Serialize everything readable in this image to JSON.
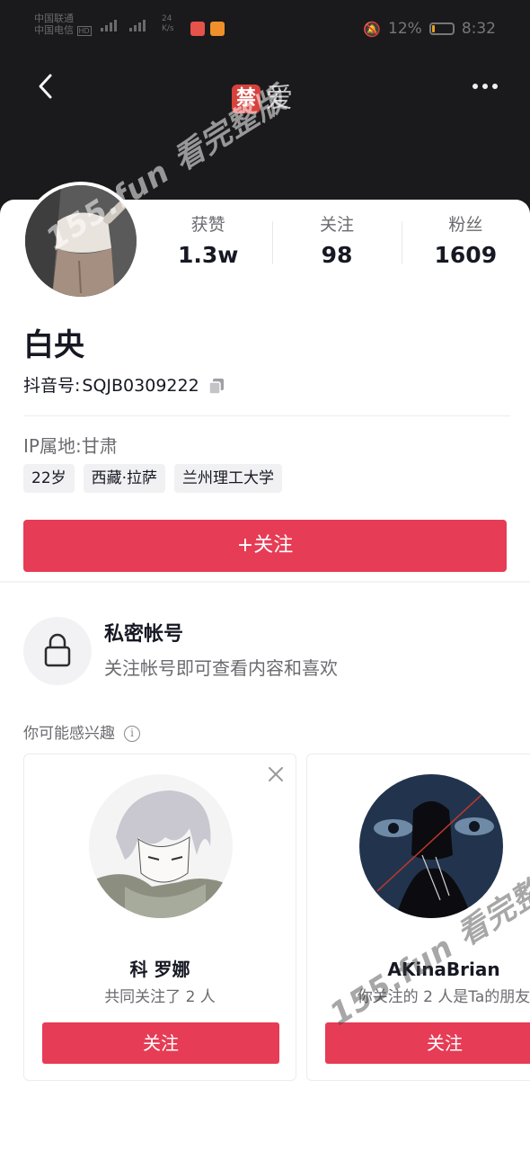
{
  "status_bar": {
    "carrier_1": "中国联通",
    "carrier_2": "中国电信",
    "hd": "HD",
    "speed_value": "24",
    "speed_unit": "K/s",
    "battery_percent": "12%",
    "battery_level": 0.12,
    "time": "8:32"
  },
  "header": {
    "ban_badge": "禁",
    "ban_text": "爱",
    "back_icon": "chevron-left-icon",
    "more_icon": "more-dots-icon"
  },
  "watermarks": [
    "155.fun 看完整版",
    "155.fun 看完整版"
  ],
  "profile": {
    "stats": [
      {
        "label": "获赞",
        "value": "1.3w"
      },
      {
        "label": "关注",
        "value": "98"
      },
      {
        "label": "粉丝",
        "value": "1609"
      }
    ],
    "name": "白央",
    "douyin_id_label": "抖音号:",
    "douyin_id": "SQJB0309222",
    "ip_location": "IP属地:甘肃",
    "tags": [
      "22岁",
      "西藏·拉萨",
      "兰州理工大学"
    ],
    "follow_button": "+关注"
  },
  "private": {
    "title": "私密帐号",
    "description": "关注帐号即可查看内容和喜欢"
  },
  "recommend": {
    "heading": "你可能感兴趣",
    "cards": [
      {
        "name": "科 罗娜",
        "subtitle": "共同关注了 2 人",
        "button": "关注"
      },
      {
        "name": "AKinaBrian",
        "subtitle": "你关注的 2 人是Ta的朋友",
        "button": "关注"
      }
    ]
  },
  "colors": {
    "accent": "#e63c55",
    "header_bg": "#1a1a1c",
    "ban_badge": "#d7423c"
  }
}
